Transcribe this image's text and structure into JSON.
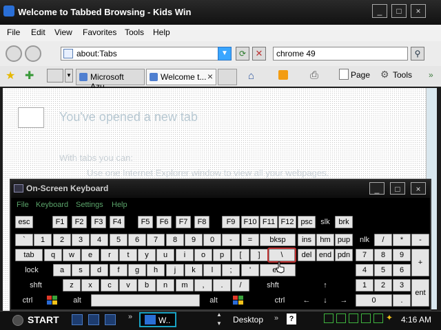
{
  "window": {
    "title": "Welcome to Tabbed Browsing - Kids Win",
    "menu": [
      "File",
      "Edit",
      "View",
      "Favorites",
      "Tools",
      "Help"
    ]
  },
  "address_bar": {
    "url": "about:Tabs"
  },
  "search": {
    "value": "chrome 49"
  },
  "tabs": [
    {
      "label": "Microsoft Azu..."
    },
    {
      "label": "Welcome t..."
    }
  ],
  "command_bar": {
    "page_label": "Page",
    "tools_label": "Tools"
  },
  "content": {
    "heading": "You've opened a new tab",
    "intro": "With tabs you can:",
    "bullet": "Use one Internet Explorer window to view all your webpages."
  },
  "osk": {
    "title": "On-Screen Keyboard",
    "menu": [
      "File",
      "Keyboard",
      "Settings",
      "Help"
    ],
    "rows": {
      "fn": [
        "esc",
        "F1",
        "F2",
        "F3",
        "F4",
        "F5",
        "F6",
        "F7",
        "F8",
        "F9",
        "F10",
        "F11",
        "F12",
        "psc",
        "slk",
        "brk"
      ],
      "num": [
        "`",
        "1",
        "2",
        "3",
        "4",
        "5",
        "6",
        "7",
        "8",
        "9",
        "0",
        "-",
        "=",
        "bksp",
        "ins",
        "hm",
        "pup",
        "nlk",
        "/",
        "*",
        "-"
      ],
      "top": [
        "tab",
        "q",
        "w",
        "e",
        "r",
        "t",
        "y",
        "u",
        "i",
        "o",
        "p",
        "[",
        "]",
        "\\",
        "del",
        "end",
        "pdn",
        "7",
        "8",
        "9",
        "+"
      ],
      "home": [
        "lock",
        "a",
        "s",
        "d",
        "f",
        "g",
        "h",
        "j",
        "k",
        "l",
        ";",
        "'",
        "ent",
        "4",
        "5",
        "6"
      ],
      "shift": [
        "shft",
        "z",
        "x",
        "c",
        "v",
        "b",
        "n",
        "m",
        ",",
        ".",
        "/",
        "shft",
        "↑",
        "1",
        "2",
        "3",
        "ent"
      ],
      "bottom": [
        "ctrl",
        "alt",
        "alt",
        "ctrl",
        "←",
        "↓",
        "→",
        "0",
        "."
      ]
    },
    "selected_key": "\\"
  },
  "taskbar": {
    "start": "START",
    "task": "W..",
    "desktop": "Desktop",
    "help": "?",
    "clock": "4:16 AM"
  }
}
